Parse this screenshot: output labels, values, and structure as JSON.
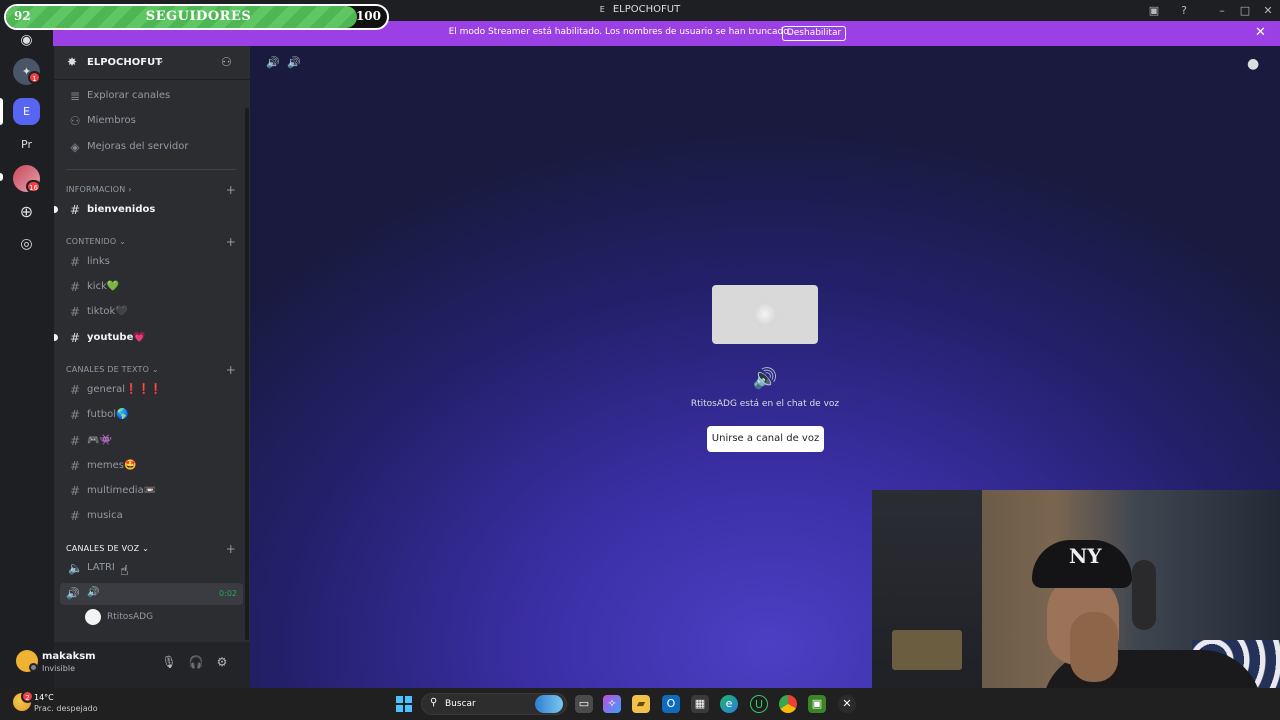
{
  "window": {
    "title": "ELPOCHOFUT",
    "title_prefix": "E"
  },
  "followers": {
    "current": "92",
    "label": "SEGUIDORES",
    "goal": "100",
    "progress": 0.92
  },
  "banner": {
    "text": "El modo Streamer está habilitado. Los nombres de usuario se han truncado.",
    "button": "Deshabilitar",
    "bg_color": "#9b40e4"
  },
  "rail": {
    "servers": [
      {
        "name": "direct-messages",
        "icon": "discord-icon"
      },
      {
        "name": "server-1",
        "badge": "1"
      },
      {
        "name": "server-elpochofut",
        "letter": "E",
        "active": true
      },
      {
        "name": "server-pr",
        "letter": "Pr"
      },
      {
        "name": "server-4",
        "badge": "16"
      },
      {
        "name": "add-server",
        "icon": "plus-icon"
      },
      {
        "name": "discover",
        "icon": "compass-icon"
      }
    ]
  },
  "server": {
    "name": "ELPOCHOFUT"
  },
  "nav": {
    "items": [
      {
        "label": "Explorar canales",
        "icon": "browse-channels-icon"
      },
      {
        "label": "Miembros",
        "icon": "members-icon"
      },
      {
        "label": "Mejoras del servidor",
        "icon": "boost-icon"
      }
    ]
  },
  "categories": {
    "informacion": {
      "label": "INFORMACION",
      "channels": [
        {
          "label": "bienvenidos",
          "unread": true
        }
      ]
    },
    "contenido": {
      "label": "CONTENIDO",
      "channels": [
        {
          "label": "links"
        },
        {
          "label": "kick💚"
        },
        {
          "label": "tiktok🖤"
        },
        {
          "label": "youtube💗",
          "unread": true
        }
      ]
    },
    "texto": {
      "label": "CANALES DE TEXTO",
      "channels": [
        {
          "label": "general❗❗❗"
        },
        {
          "label": "futbol🌎"
        },
        {
          "label": "🎮👾"
        },
        {
          "label": "memes🤩"
        },
        {
          "label": "multimedia📼"
        },
        {
          "label": "musica"
        }
      ]
    },
    "voz": {
      "label": "CANALES DE VOZ",
      "channels": [
        {
          "label": "LATRI"
        },
        {
          "label": "🔊",
          "timer": "0:02",
          "member": "RtitosADG"
        }
      ]
    }
  },
  "user": {
    "name": "makaksm",
    "status": "Invisible"
  },
  "voice_stage": {
    "message": "RtitosADG está en el chat de voz",
    "join_button": "Unirse a canal de voz"
  },
  "taskbar": {
    "temperature": "14°C",
    "weather": "Prac. despejado",
    "search_placeholder": "Buscar",
    "notification_badge": "2"
  }
}
